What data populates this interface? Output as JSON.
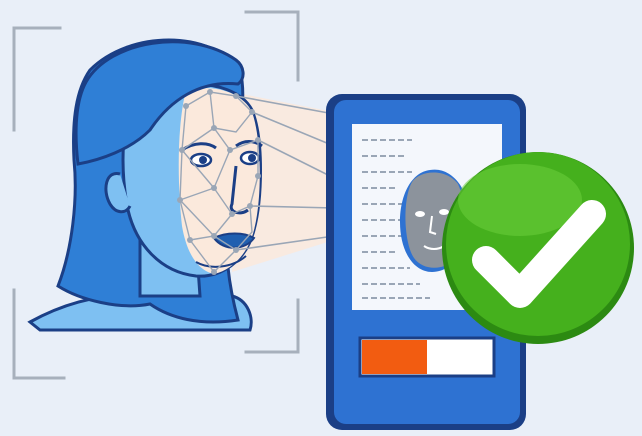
{
  "illustration": {
    "subject": "face-recognition-verification",
    "icons": [
      "face-scan-icon",
      "phone-icon",
      "check-icon"
    ],
    "colors": {
      "background": "#e9eff8",
      "hair": "#2f7fd6",
      "hair_dark": "#1f5fb0",
      "outline": "#1b3f86",
      "skin": "#7ec0f2",
      "skin_light": "#fbe9dc",
      "phone_body": "#2e72d2",
      "phone_frame": "#1b3f86",
      "screen": "#f4f7fc",
      "progress_fill": "#f25c11",
      "progress_empty": "#ffffff",
      "check_green": "#45b01d",
      "check_green_dark": "#2c8a12",
      "scan_lines": "#9aa6b6",
      "bracket": "#a7b0bc"
    },
    "progress": {
      "value": 0.5
    }
  }
}
